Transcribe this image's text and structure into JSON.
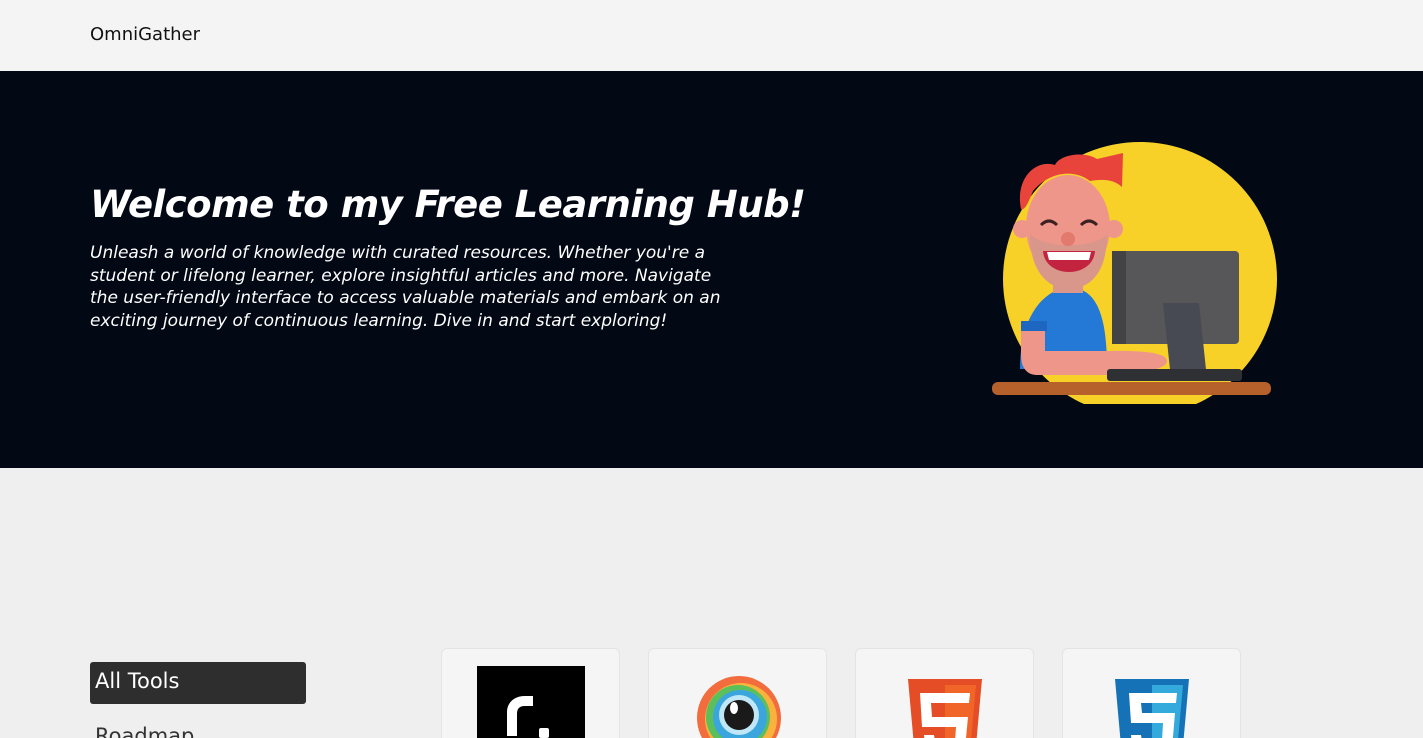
{
  "header": {
    "brand": "OmniGather"
  },
  "hero": {
    "title": "Welcome to my Free Learning Hub!",
    "description": "Unleash a world of knowledge with curated resources. Whether you're a student or lifelong learner, explore insightful articles and more. Navigate the user-friendly interface to access valuable materials and embark on an exciting journey of continuous learning. Dive in and start exploring!",
    "illustration": "person-at-computer-illustration"
  },
  "filters": {
    "active": "All Tools",
    "items": [
      "Roadmap"
    ]
  },
  "tools": [
    {
      "icon": "black-square-logo-icon"
    },
    {
      "icon": "rainbow-eye-logo-icon"
    },
    {
      "icon": "html5-logo-icon"
    },
    {
      "icon": "css3-logo-icon"
    }
  ],
  "colors": {
    "hero_bg": "#020814",
    "topbar_bg": "#f4f4f4",
    "active_filter_bg": "#2e2e2e",
    "illustration_circle": "#f7d128"
  }
}
